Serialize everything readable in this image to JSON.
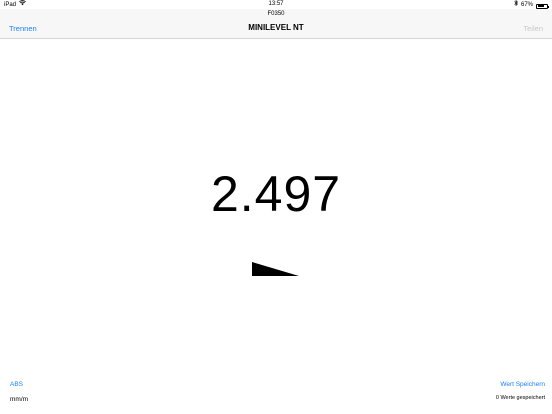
{
  "status_bar": {
    "device": "iPad",
    "time": "13:57",
    "battery_text": "67%",
    "battery_level": 0.67,
    "wifi_icon": "wifi-icon",
    "bluetooth_icon": "bluetooth-icon"
  },
  "nav": {
    "device_id": "F0350",
    "title": "MINILEVEL NT",
    "left_button": "Trennen",
    "right_button": "Teilen"
  },
  "measurement": {
    "value": "2.497",
    "indicator_icon": "tilt-wedge-icon"
  },
  "footer": {
    "mode_button": "ABS",
    "unit": "mm/m",
    "save_button": "Wert Speichern",
    "saved_count": "0 Werte gespeichert"
  },
  "colors": {
    "accent": "#1a82fb",
    "disabled": "#c8c8c8",
    "nav_background": "#f7f7f7"
  }
}
